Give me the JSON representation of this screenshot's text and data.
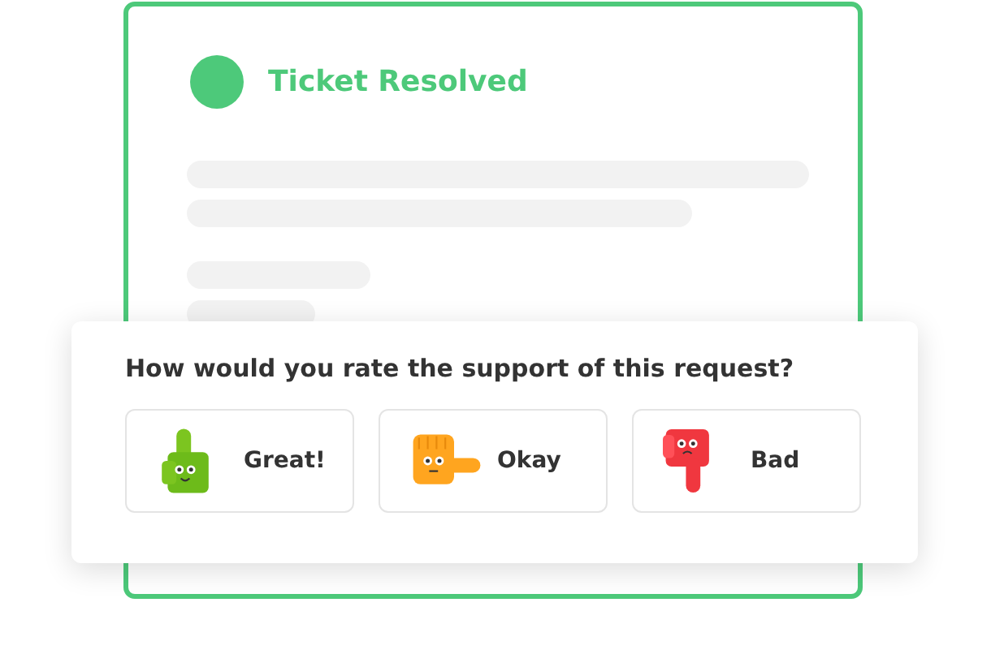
{
  "ticket": {
    "status": "Ticket Resolved"
  },
  "rating": {
    "question": "How would you rate the support of this request?",
    "options": [
      {
        "kind": "thumbs_up",
        "label": "Great!"
      },
      {
        "kind": "sideways",
        "label": "Okay"
      },
      {
        "kind": "thumbs_down",
        "label": "Bad"
      }
    ]
  }
}
